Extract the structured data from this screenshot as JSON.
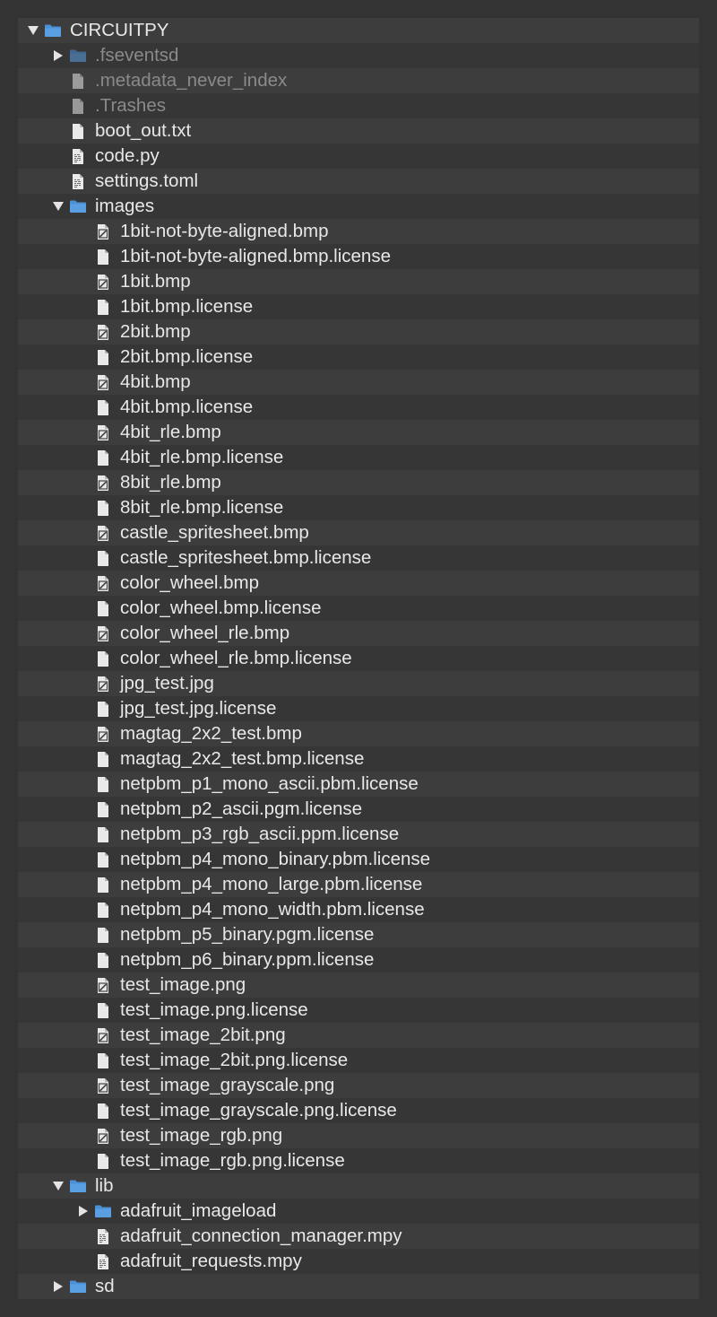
{
  "colors": {
    "background": "#333333",
    "row_light": "#3d3d3d",
    "row_dark": "#363636",
    "folder": "#4a90d6",
    "text": "#e8e8e8",
    "text_dim": "#8a8a8a"
  },
  "tree": {
    "items": [
      {
        "label": "CIRCUITPY",
        "depth": 0,
        "kind": "folder",
        "state": "open",
        "dim": false
      },
      {
        "label": ".fseventsd",
        "depth": 1,
        "kind": "folder",
        "state": "closed",
        "dim": true
      },
      {
        "label": ".metadata_never_index",
        "depth": 1,
        "kind": "file",
        "dim": true
      },
      {
        "label": ".Trashes",
        "depth": 1,
        "kind": "file",
        "dim": true
      },
      {
        "label": "boot_out.txt",
        "depth": 1,
        "kind": "file",
        "dim": false
      },
      {
        "label": "code.py",
        "depth": 1,
        "kind": "code",
        "dim": false
      },
      {
        "label": "settings.toml",
        "depth": 1,
        "kind": "code",
        "dim": false
      },
      {
        "label": "images",
        "depth": 1,
        "kind": "folder",
        "state": "open",
        "dim": false
      },
      {
        "label": "1bit-not-byte-aligned.bmp",
        "depth": 2,
        "kind": "image",
        "dim": false
      },
      {
        "label": "1bit-not-byte-aligned.bmp.license",
        "depth": 2,
        "kind": "file",
        "dim": false
      },
      {
        "label": "1bit.bmp",
        "depth": 2,
        "kind": "image",
        "dim": false
      },
      {
        "label": "1bit.bmp.license",
        "depth": 2,
        "kind": "file",
        "dim": false
      },
      {
        "label": "2bit.bmp",
        "depth": 2,
        "kind": "image",
        "dim": false
      },
      {
        "label": "2bit.bmp.license",
        "depth": 2,
        "kind": "file",
        "dim": false
      },
      {
        "label": "4bit.bmp",
        "depth": 2,
        "kind": "image",
        "dim": false
      },
      {
        "label": "4bit.bmp.license",
        "depth": 2,
        "kind": "file",
        "dim": false
      },
      {
        "label": "4bit_rle.bmp",
        "depth": 2,
        "kind": "image",
        "dim": false
      },
      {
        "label": "4bit_rle.bmp.license",
        "depth": 2,
        "kind": "file",
        "dim": false
      },
      {
        "label": "8bit_rle.bmp",
        "depth": 2,
        "kind": "image",
        "dim": false
      },
      {
        "label": "8bit_rle.bmp.license",
        "depth": 2,
        "kind": "file",
        "dim": false
      },
      {
        "label": "castle_spritesheet.bmp",
        "depth": 2,
        "kind": "image",
        "dim": false
      },
      {
        "label": "castle_spritesheet.bmp.license",
        "depth": 2,
        "kind": "file",
        "dim": false
      },
      {
        "label": "color_wheel.bmp",
        "depth": 2,
        "kind": "image",
        "dim": false
      },
      {
        "label": "color_wheel.bmp.license",
        "depth": 2,
        "kind": "file",
        "dim": false
      },
      {
        "label": "color_wheel_rle.bmp",
        "depth": 2,
        "kind": "image",
        "dim": false
      },
      {
        "label": "color_wheel_rle.bmp.license",
        "depth": 2,
        "kind": "file",
        "dim": false
      },
      {
        "label": "jpg_test.jpg",
        "depth": 2,
        "kind": "image",
        "dim": false
      },
      {
        "label": "jpg_test.jpg.license",
        "depth": 2,
        "kind": "file",
        "dim": false
      },
      {
        "label": "magtag_2x2_test.bmp",
        "depth": 2,
        "kind": "image",
        "dim": false
      },
      {
        "label": "magtag_2x2_test.bmp.license",
        "depth": 2,
        "kind": "file",
        "dim": false
      },
      {
        "label": "netpbm_p1_mono_ascii.pbm.license",
        "depth": 2,
        "kind": "file",
        "dim": false
      },
      {
        "label": "netpbm_p2_ascii.pgm.license",
        "depth": 2,
        "kind": "file",
        "dim": false
      },
      {
        "label": "netpbm_p3_rgb_ascii.ppm.license",
        "depth": 2,
        "kind": "file",
        "dim": false
      },
      {
        "label": "netpbm_p4_mono_binary.pbm.license",
        "depth": 2,
        "kind": "file",
        "dim": false
      },
      {
        "label": "netpbm_p4_mono_large.pbm.license",
        "depth": 2,
        "kind": "file",
        "dim": false
      },
      {
        "label": "netpbm_p4_mono_width.pbm.license",
        "depth": 2,
        "kind": "file",
        "dim": false
      },
      {
        "label": "netpbm_p5_binary.pgm.license",
        "depth": 2,
        "kind": "file",
        "dim": false
      },
      {
        "label": "netpbm_p6_binary.ppm.license",
        "depth": 2,
        "kind": "file",
        "dim": false
      },
      {
        "label": "test_image.png",
        "depth": 2,
        "kind": "image",
        "dim": false
      },
      {
        "label": "test_image.png.license",
        "depth": 2,
        "kind": "file",
        "dim": false
      },
      {
        "label": "test_image_2bit.png",
        "depth": 2,
        "kind": "image",
        "dim": false
      },
      {
        "label": "test_image_2bit.png.license",
        "depth": 2,
        "kind": "file",
        "dim": false
      },
      {
        "label": "test_image_grayscale.png",
        "depth": 2,
        "kind": "image",
        "dim": false
      },
      {
        "label": "test_image_grayscale.png.license",
        "depth": 2,
        "kind": "file",
        "dim": false
      },
      {
        "label": "test_image_rgb.png",
        "depth": 2,
        "kind": "image",
        "dim": false
      },
      {
        "label": "test_image_rgb.png.license",
        "depth": 2,
        "kind": "file",
        "dim": false
      },
      {
        "label": "lib",
        "depth": 1,
        "kind": "folder",
        "state": "open",
        "dim": false
      },
      {
        "label": "adafruit_imageload",
        "depth": 2,
        "kind": "folder",
        "state": "closed",
        "dim": false
      },
      {
        "label": "adafruit_connection_manager.mpy",
        "depth": 2,
        "kind": "code",
        "dim": false
      },
      {
        "label": "adafruit_requests.mpy",
        "depth": 2,
        "kind": "code",
        "dim": false
      },
      {
        "label": "sd",
        "depth": 1,
        "kind": "folder",
        "state": "closed",
        "dim": false
      }
    ]
  }
}
